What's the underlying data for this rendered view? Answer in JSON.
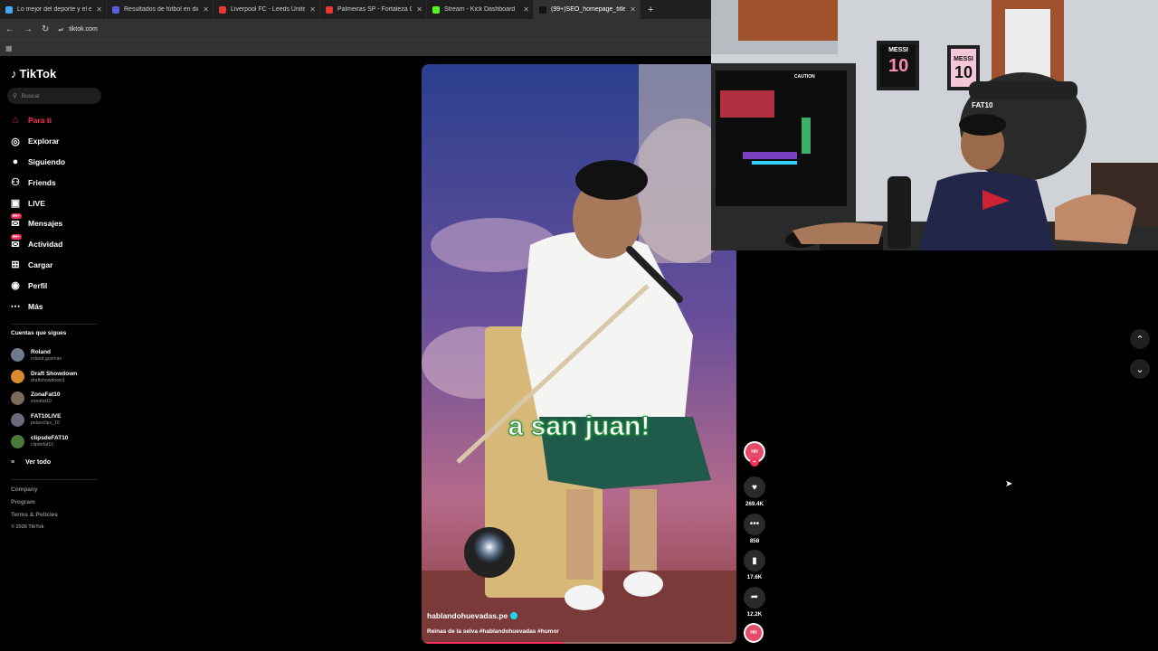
{
  "browser": {
    "tabs": [
      {
        "title": "Lo mejor del deporte y el entre",
        "color": "#3fa9f5"
      },
      {
        "title": "Resultados de fútbol en directo",
        "color": "#5b5bd6"
      },
      {
        "title": "Liverpool FC - Leeds United Fútb",
        "color": "#e53935"
      },
      {
        "title": "Palmeiras SP - Fortaleza CE Cur",
        "color": "#e53935"
      },
      {
        "title": "Stream - Kick Dashboard",
        "color": "#53fc18"
      },
      {
        "title": "(99+)SEO_homepage_title",
        "color": "#111111"
      }
    ],
    "new_tab": "+",
    "url": "tiktok.com"
  },
  "sidebar": {
    "logo": "TikTok",
    "search_placeholder": "Buscar",
    "nav": [
      {
        "label": "Para ti",
        "icon": "home-icon",
        "active": true
      },
      {
        "label": "Explorar",
        "icon": "compass-icon"
      },
      {
        "label": "Siguiendo",
        "icon": "following-avatar-icon"
      },
      {
        "label": "Friends",
        "icon": "friends-icon"
      },
      {
        "label": "LIVE",
        "icon": "live-icon"
      },
      {
        "label": "Mensajes",
        "icon": "messages-icon",
        "badge": "99+"
      },
      {
        "label": "Actividad",
        "icon": "activity-icon",
        "badge": "99+"
      },
      {
        "label": "Cargar",
        "icon": "upload-icon"
      },
      {
        "label": "Perfil",
        "icon": "profile-icon"
      },
      {
        "label": "Más",
        "icon": "more-icon"
      }
    ],
    "following_header": "Cuentas que sigues",
    "following": [
      {
        "name": "Roland",
        "handle": "roland.guzman",
        "color": "#6d7b8c"
      },
      {
        "name": "Draft Showdown",
        "handle": "draftshowdown1",
        "color": "#d98b2b"
      },
      {
        "name": "ZonaFat10",
        "handle": "zonafat10",
        "color": "#7a6a5a"
      },
      {
        "name": "FAT10LIVE",
        "handle": "pelaoclips_10",
        "color": "#6a6a7a"
      },
      {
        "name": "clipsdeFAT10",
        "handle": "clipdefat10",
        "color": "#4a7a3a"
      }
    ],
    "see_all": "Ver todo",
    "footer": [
      "Company",
      "Program",
      "Terms & Policies"
    ],
    "copyright": "© 2026 TikTok"
  },
  "video": {
    "caption_overlay": "a san juan!",
    "author": "hablandohuevadas.pe",
    "description": "Reinas de la selva #hablandohuevadas #humor",
    "progress": 0.45
  },
  "actions": {
    "likes": "269.4K",
    "comments": "858",
    "saves": "17.6K",
    "shares": "12.2K"
  },
  "webcam": {
    "poster1": "10",
    "poster1_title": "MESSI",
    "poster2": "10",
    "poster2_title": "MESSI",
    "chair_label": "FAT10",
    "pc_label": "CAUTION"
  }
}
